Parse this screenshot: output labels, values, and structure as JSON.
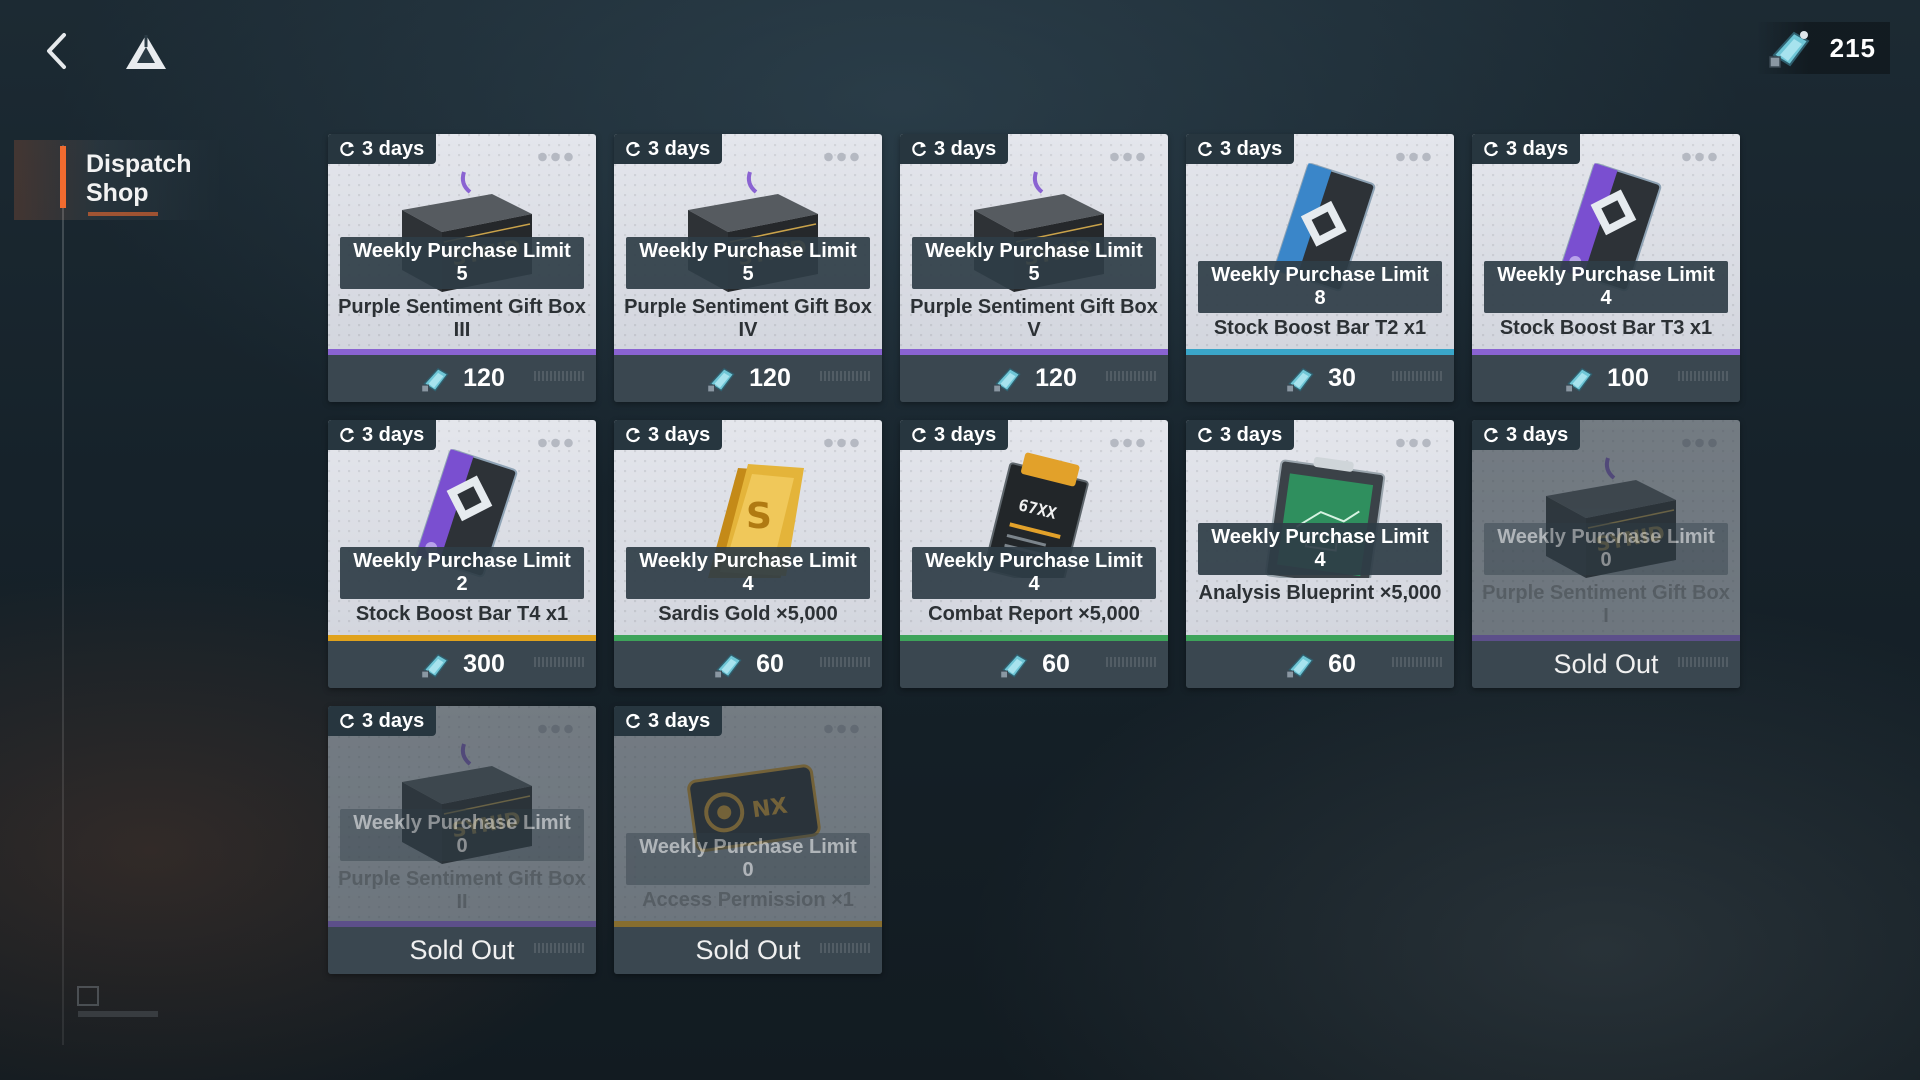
{
  "header": {
    "back_icon": "chevron-left-icon",
    "home_icon": "triangle-logo-icon",
    "currency": {
      "icon": "dispatch-token-icon",
      "value": "215"
    }
  },
  "sidebar": {
    "items": [
      {
        "label": "Dispatch Shop",
        "active": true
      }
    ]
  },
  "shop": {
    "items": [
      {
        "timer": "3 days",
        "limit": "Weekly Purchase Limit 5",
        "name": "Purple Sentiment Gift Box III",
        "price": "120",
        "sold_out": false,
        "rarity_color": "#8a63d2",
        "art": "gift-box"
      },
      {
        "timer": "3 days",
        "limit": "Weekly Purchase Limit 5",
        "name": "Purple Sentiment Gift Box IV",
        "price": "120",
        "sold_out": false,
        "rarity_color": "#8a63d2",
        "art": "gift-box"
      },
      {
        "timer": "3 days",
        "limit": "Weekly Purchase Limit 5",
        "name": "Purple Sentiment Gift Box V",
        "price": "120",
        "sold_out": false,
        "rarity_color": "#8a63d2",
        "art": "gift-box"
      },
      {
        "timer": "3 days",
        "limit": "Weekly Purchase Limit 8",
        "name": "Stock Boost Bar T2 x1",
        "price": "30",
        "sold_out": false,
        "rarity_color": "#3aa6c9",
        "art": "card-blue"
      },
      {
        "timer": "3 days",
        "limit": "Weekly Purchase Limit 4",
        "name": "Stock Boost Bar T3 x1",
        "price": "100",
        "sold_out": false,
        "rarity_color": "#8a63d2",
        "art": "card-purple"
      },
      {
        "timer": "3 days",
        "limit": "Weekly Purchase Limit 2",
        "name": "Stock Boost Bar T4 x1",
        "price": "300",
        "sold_out": false,
        "rarity_color": "#e0a21c",
        "art": "card-purple"
      },
      {
        "timer": "3 days",
        "limit": "Weekly Purchase Limit 4",
        "name": "Sardis Gold ×5,000",
        "price": "60",
        "sold_out": false,
        "rarity_color": "#3da35a",
        "art": "gold"
      },
      {
        "timer": "3 days",
        "limit": "Weekly Purchase Limit 4",
        "name": "Combat Report ×5,000",
        "price": "60",
        "sold_out": false,
        "rarity_color": "#3da35a",
        "art": "report"
      },
      {
        "timer": "3 days",
        "limit": "Weekly Purchase Limit 4",
        "name": "Analysis Blueprint ×5,000",
        "price": "60",
        "sold_out": false,
        "rarity_color": "#3da35a",
        "art": "blueprint"
      },
      {
        "timer": "3 days",
        "limit": "Weekly Purchase Limit 0",
        "name": "Purple Sentiment Gift Box I",
        "price": "",
        "sold_out": true,
        "sold_label": "Sold Out",
        "rarity_color": "#8a63d2",
        "art": "gift-box"
      },
      {
        "timer": "3 days",
        "limit": "Weekly Purchase Limit 0",
        "name": "Purple Sentiment Gift Box II",
        "price": "",
        "sold_out": true,
        "sold_label": "Sold Out",
        "rarity_color": "#8a63d2",
        "art": "gift-box"
      },
      {
        "timer": "3 days",
        "limit": "Weekly Purchase Limit 0",
        "name": "Access Permission ×1",
        "price": "",
        "sold_out": true,
        "sold_label": "Sold Out",
        "rarity_color": "#e0a21c",
        "art": "access-card"
      }
    ]
  }
}
